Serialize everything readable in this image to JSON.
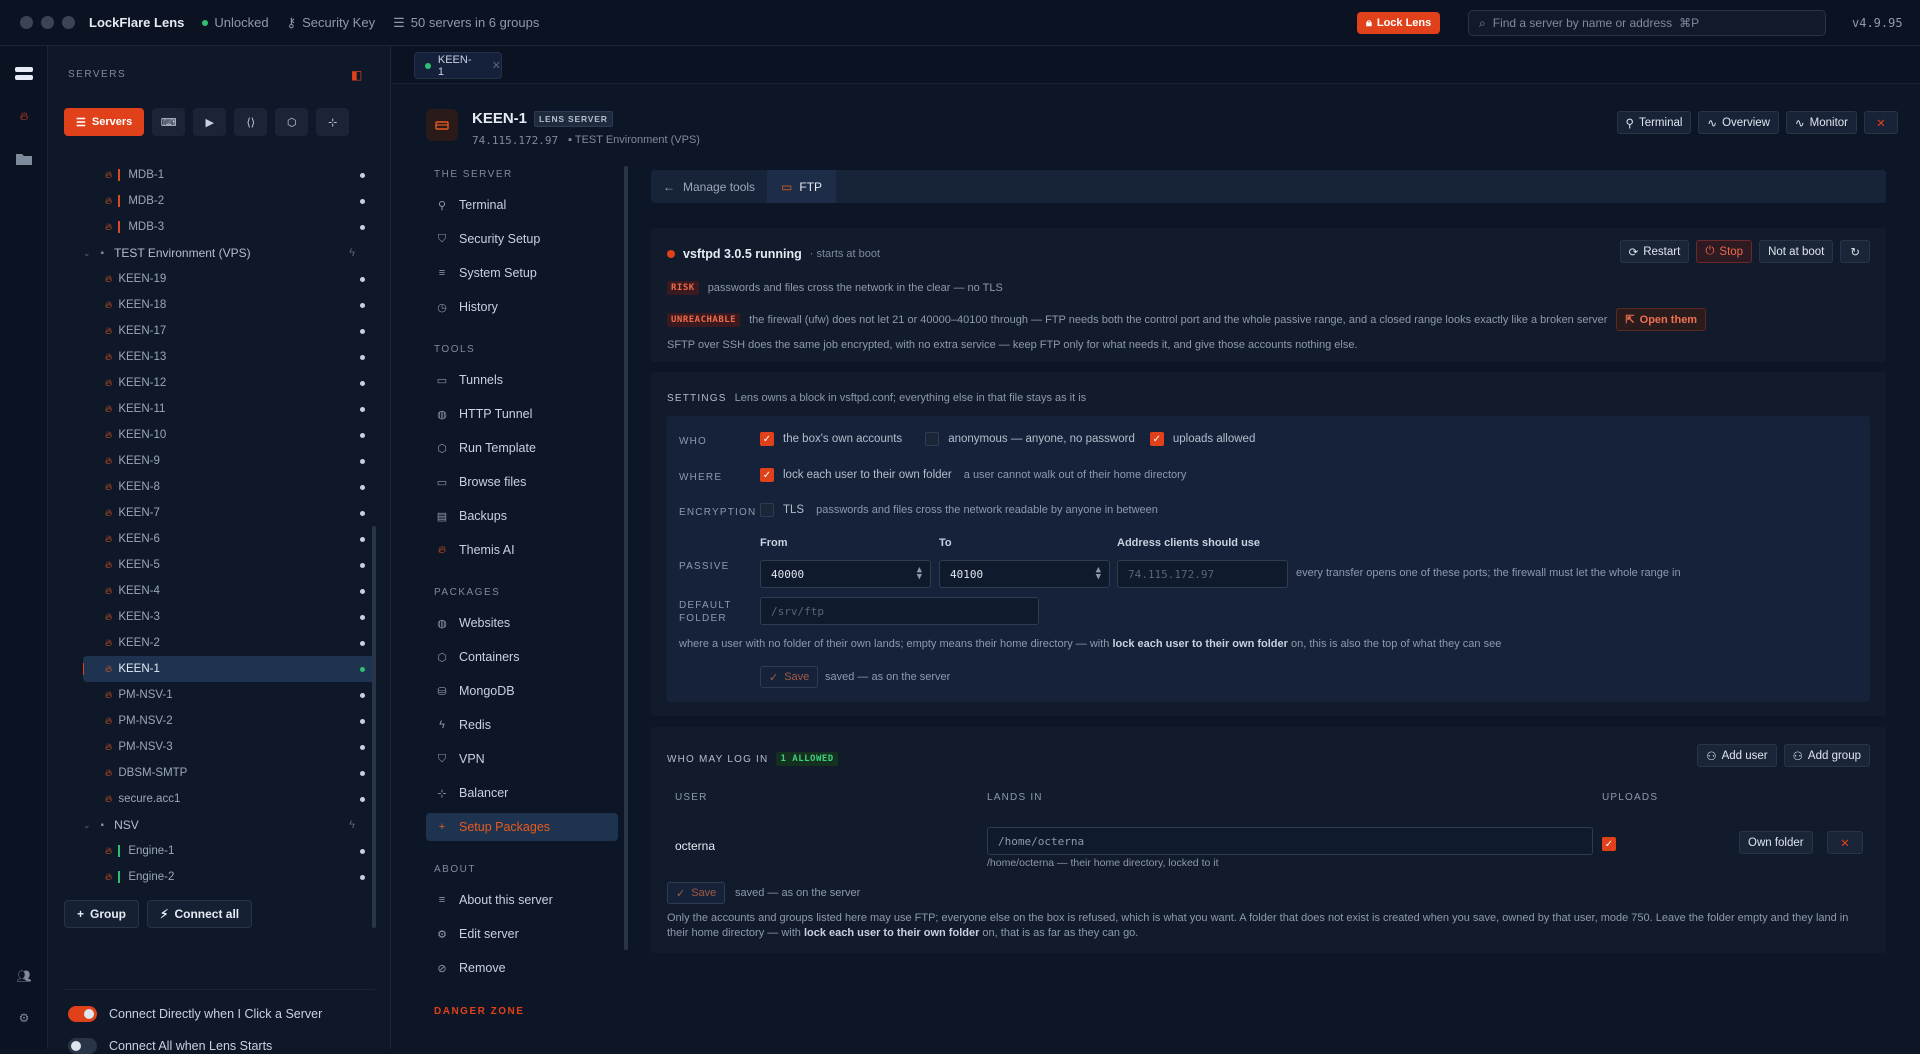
{
  "titlebar": {
    "app_name": "LockFlare Lens",
    "status": "Unlocked",
    "key": "Security Key",
    "servers_count": "50 servers in 6 groups",
    "lock_label": "Lock Lens",
    "search_placeholder": "Find a server by name or address",
    "search_shortcut": "⌘P",
    "version": "v4.9.95"
  },
  "sidebar": {
    "heading": "SERVERS",
    "tabs": {
      "servers_label": "Servers"
    },
    "tree": [
      {
        "type": "server",
        "name": "MDB-1",
        "bar": "red"
      },
      {
        "type": "server",
        "name": "MDB-2",
        "bar": "red"
      },
      {
        "type": "server",
        "name": "MDB-3",
        "bar": "red"
      },
      {
        "type": "group",
        "name": "TEST Environment (VPS)"
      },
      {
        "type": "server",
        "name": "KEEN-19"
      },
      {
        "type": "server",
        "name": "KEEN-18"
      },
      {
        "type": "server",
        "name": "KEEN-17"
      },
      {
        "type": "server",
        "name": "KEEN-13"
      },
      {
        "type": "server",
        "name": "KEEN-12"
      },
      {
        "type": "server",
        "name": "KEEN-11"
      },
      {
        "type": "server",
        "name": "KEEN-10"
      },
      {
        "type": "server",
        "name": "KEEN-9"
      },
      {
        "type": "server",
        "name": "KEEN-8"
      },
      {
        "type": "server",
        "name": "KEEN-7"
      },
      {
        "type": "server",
        "name": "KEEN-6"
      },
      {
        "type": "server",
        "name": "KEEN-5"
      },
      {
        "type": "server",
        "name": "KEEN-4"
      },
      {
        "type": "server",
        "name": "KEEN-3"
      },
      {
        "type": "server",
        "name": "KEEN-2"
      },
      {
        "type": "server",
        "name": "KEEN-1",
        "selected": true
      },
      {
        "type": "server",
        "name": "PM-NSV-1"
      },
      {
        "type": "server",
        "name": "PM-NSV-2"
      },
      {
        "type": "server",
        "name": "PM-NSV-3"
      },
      {
        "type": "server",
        "name": "DBSM-SMTP"
      },
      {
        "type": "server",
        "name": "secure.acc1"
      },
      {
        "type": "group",
        "name": "NSV"
      },
      {
        "type": "server",
        "name": "Engine-1",
        "bar": "green"
      },
      {
        "type": "server",
        "name": "Engine-2",
        "bar": "green"
      }
    ],
    "group_button": "Group",
    "connect_all_button": "Connect all",
    "toggle_connect_directly": {
      "label": "Connect Directly when I Click a Server",
      "on": true
    },
    "toggle_connect_all": {
      "label": "Connect All when Lens Starts",
      "on": false
    }
  },
  "tabbar": {
    "tab_label": "KEEN-1"
  },
  "header": {
    "name": "KEEN-1",
    "badge": "LENS SERVER",
    "address": "74.115.172.97",
    "group": "TEST Environment (VPS)",
    "terminal": "Terminal",
    "overview": "Overview",
    "monitor": "Monitor"
  },
  "subnav": {
    "the_server": "THE SERVER",
    "terminal": "Terminal",
    "security_setup": "Security Setup",
    "system_setup": "System Setup",
    "history": "History",
    "tools": "TOOLS",
    "tunnels": "Tunnels",
    "http_tunnel": "HTTP Tunnel",
    "run_template": "Run Template",
    "browse_files": "Browse files",
    "backups": "Backups",
    "themis": "Themis AI",
    "packages": "PACKAGES",
    "websites": "Websites",
    "containers": "Containers",
    "mongodb": "MongoDB",
    "redis": "Redis",
    "vpn": "VPN",
    "balancer": "Balancer",
    "setup_packages": "Setup Packages",
    "about": "ABOUT",
    "about_server": "About this server",
    "edit_server": "Edit server",
    "remove": "Remove",
    "danger": "DANGER ZONE"
  },
  "breadcrumb": {
    "back": "Manage tools",
    "current": "FTP"
  },
  "service": {
    "name": "vsftpd 3.0.5 running",
    "boot": "· starts at boot",
    "restart": "Restart",
    "stop": "Stop",
    "not_at_boot": "Not at boot",
    "risk_pill": "RISK",
    "risk_text": "passwords and files cross the network in the clear — no TLS",
    "unreach_pill": "UNREACHABLE",
    "unreach_text": "the firewall (ufw) does not let 21 or 40000–40100 through — FTP needs both the control port and the whole passive range, and a closed range looks exactly like a broken server",
    "open_them": "Open them",
    "sftp_note": "SFTP over SSH does the same job encrypted, with no extra service — keep FTP only for what needs it, and give those accounts nothing else."
  },
  "settings": {
    "title": "SETTINGS",
    "subtitle": "Lens owns a block in vsftpd.conf; everything else in that file stays as it is",
    "who_label": "WHO",
    "own_accounts": {
      "label": "the box's own accounts",
      "checked": true
    },
    "anonymous": {
      "label": "anonymous — anyone, no password",
      "checked": false
    },
    "uploads": {
      "label": "uploads allowed",
      "checked": true
    },
    "where_label": "WHERE",
    "lock_user": {
      "label": "lock each user to their own folder",
      "checked": true
    },
    "lock_hint": "a user cannot walk out of their home directory",
    "enc_label": "ENCRYPTION",
    "tls": {
      "label": "TLS",
      "checked": false
    },
    "tls_hint": "passwords and files cross the network readable by anyone in between",
    "passive_label": "PASSIVE",
    "from_label": "From",
    "to_label": "To",
    "addr_label": "Address clients should use",
    "from_value": "40000",
    "to_value": "40100",
    "addr_placeholder": "74.115.172.97",
    "passive_hint": "every transfer opens one of these ports; the firewall must let the whole range in",
    "default_label_1": "DEFAULT",
    "default_label_2": "FOLDER",
    "default_placeholder": "/srv/ftp",
    "default_note_a": "where a user with no folder of their own lands; empty means their home directory — with ",
    "default_note_b": "lock each user to their own folder",
    "default_note_c": " on, this is also the top of what they can see",
    "save": "Save",
    "saved": "saved — as on the server"
  },
  "users": {
    "title": "WHO MAY LOG IN",
    "allowed": "1 ALLOWED",
    "add_user": "Add user",
    "add_group": "Add group",
    "col_user": "USER",
    "col_lands": "LANDS IN",
    "col_uploads": "UPLOADS",
    "rows": [
      {
        "user": "octerna",
        "lands": "/home/octerna",
        "hint": "/home/octerna — their home directory, locked to it",
        "uploads": true,
        "own_folder": "Own folder"
      }
    ],
    "save": "Save",
    "saved": "saved — as on the server",
    "note_a": "Only the accounts and groups listed here may use FTP; everyone else on the box is refused, which is what you want. A folder that does not exist is created when you save, owned by that user, mode 750. Leave the folder empty and they land in",
    "note_b": "their home directory — with ",
    "note_c": "lock each user to their own folder",
    "note_d": " on, that is as far as they can go."
  },
  "colors": {
    "accent": "#e0411a",
    "bg": "#0d1626",
    "panel": "#111b2c",
    "selected": "#1e3350",
    "ok": "#2fbf71"
  }
}
